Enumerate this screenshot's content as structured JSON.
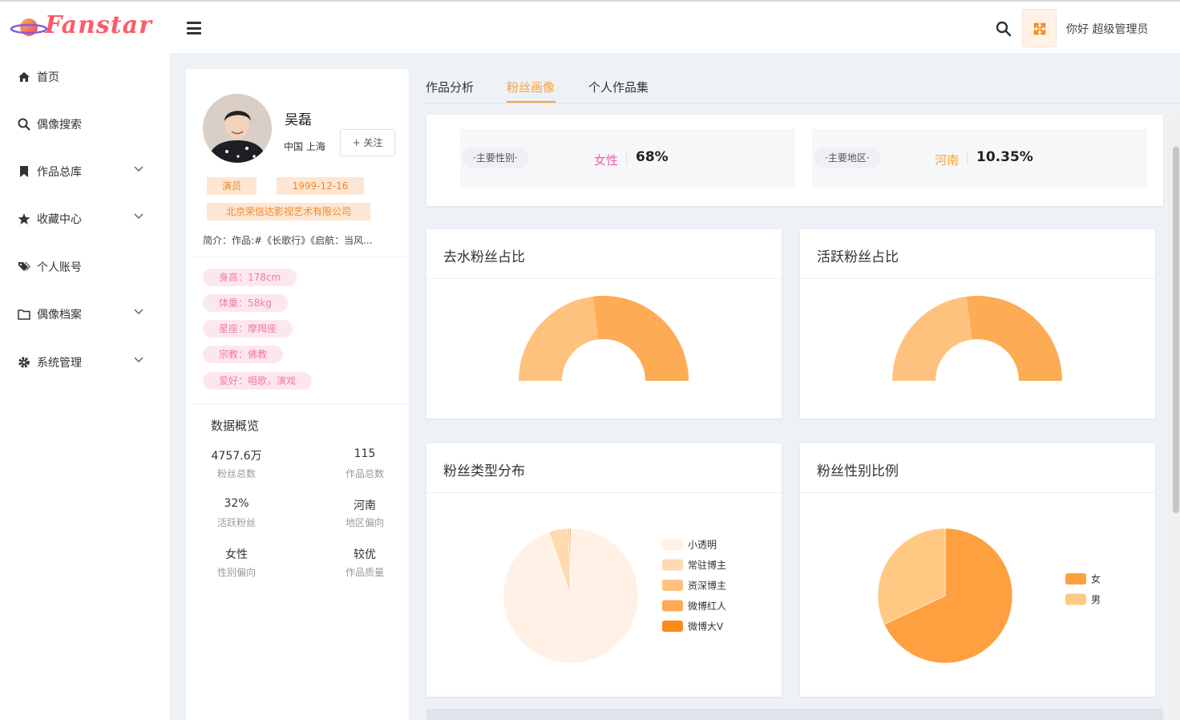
{
  "app": {
    "logo_text": "Fanstar",
    "greeting": "你好 超级管理员"
  },
  "sidebar": {
    "items": [
      {
        "label": "首页",
        "icon": "home-icon",
        "expandable": false
      },
      {
        "label": "偶像搜索",
        "icon": "search-icon",
        "expandable": false
      },
      {
        "label": "作品总库",
        "icon": "bookmark-icon",
        "expandable": true
      },
      {
        "label": "收藏中心",
        "icon": "star-icon",
        "expandable": true
      },
      {
        "label": "个人账号",
        "icon": "tags-icon",
        "expandable": false
      },
      {
        "label": "偶像档案",
        "icon": "folder-icon",
        "expandable": true
      },
      {
        "label": "系统管理",
        "icon": "gear-icon",
        "expandable": true
      }
    ]
  },
  "profile": {
    "name": "吴磊",
    "location": "中国  上海",
    "follow_label": "+ 关注",
    "tags": [
      "演员",
      "1999-12-16",
      "北京荣信达影视艺术有限公司"
    ],
    "intro": "简介：作品:#《长歌行》《启航：当风...",
    "attributes": [
      "身高：178cm",
      "体重：58kg",
      "星座：摩羯座",
      "宗教：佛教",
      "爱好：唱歌，演戏"
    ],
    "overview_title": "数据概览",
    "stats": [
      {
        "value": "4757.6万",
        "label": "粉丝总数"
      },
      {
        "value": "115",
        "label": "作品总数"
      },
      {
        "value": "32%",
        "label": "活跃粉丝"
      },
      {
        "value": "河南",
        "label": "地区偏向"
      },
      {
        "value": "女性",
        "label": "性别偏向"
      },
      {
        "value": "较优",
        "label": "作品质量"
      }
    ]
  },
  "tabs": [
    {
      "label": "作品分析",
      "active": false
    },
    {
      "label": "粉丝画像",
      "active": true
    },
    {
      "label": "个人作品集",
      "active": false
    }
  ],
  "summary": {
    "gender": {
      "pill": "·主要性别·",
      "key": "女性",
      "value": "68%",
      "key_color": "#f25cb0"
    },
    "region": {
      "pill": "·主要地区·",
      "key": "河南",
      "value": "10.35%",
      "key_color": "#f7a23a"
    }
  },
  "charts": {
    "titles": [
      "去水粉丝占比",
      "活跃粉丝占比",
      "粉丝类型分布",
      "粉丝性别比例"
    ],
    "colors": {
      "light": "#fec27e",
      "mid": "#fdab54",
      "orange": "#ffa040"
    }
  },
  "chart_data": [
    {
      "type": "pie",
      "title": "去水粉丝占比",
      "variant": "half-donut",
      "values": [
        0.46,
        0.54
      ]
    },
    {
      "type": "pie",
      "title": "活跃粉丝占比",
      "variant": "half-donut",
      "values": [
        0.46,
        0.54
      ]
    },
    {
      "type": "pie",
      "title": "粉丝类型分布",
      "legend": [
        "小透明",
        "常驻博主",
        "资深博主",
        "微博红人",
        "微博大V"
      ],
      "values": [
        0.946,
        0.046,
        0.004,
        0.003,
        0.001
      ],
      "colors": [
        "#fff1e5",
        "#ffd9b0",
        "#fec27e",
        "#fdab54",
        "#fa8b1a"
      ]
    },
    {
      "type": "pie",
      "title": "粉丝性别比例",
      "legend": [
        "女",
        "男"
      ],
      "values": [
        0.68,
        0.32
      ],
      "colors": [
        "#ffa040",
        "#ffc984"
      ]
    }
  ]
}
